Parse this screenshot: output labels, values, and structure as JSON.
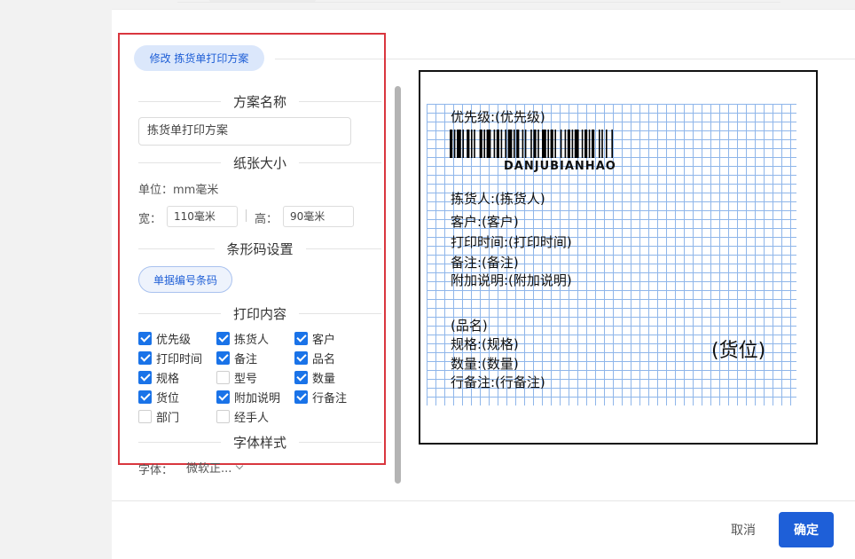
{
  "scheme_tag": "修改 拣货单打印方案",
  "sections": {
    "scheme_name": "方案名称",
    "paper_size": "纸张大小",
    "barcode_settings": "条形码设置",
    "print_content": "打印内容",
    "font_style": "字体样式"
  },
  "scheme_name_value": "拣货单打印方案",
  "unit_text": "单位：mm毫米",
  "width_label": "宽：",
  "width_value": "110毫米",
  "height_label": "高：",
  "height_value": "90毫米",
  "barcode_button": "单据编号条码",
  "print_items": [
    {
      "label": "优先级",
      "checked": true
    },
    {
      "label": "拣货人",
      "checked": true
    },
    {
      "label": "客户",
      "checked": true
    },
    {
      "label": "打印时间",
      "checked": true
    },
    {
      "label": "备注",
      "checked": true
    },
    {
      "label": "品名",
      "checked": true
    },
    {
      "label": "规格",
      "checked": true
    },
    {
      "label": "型号",
      "checked": false
    },
    {
      "label": "数量",
      "checked": true
    },
    {
      "label": "货位",
      "checked": true
    },
    {
      "label": "附加说明",
      "checked": true
    },
    {
      "label": "行备注",
      "checked": true
    },
    {
      "label": "部门",
      "checked": false
    },
    {
      "label": "经手人",
      "checked": false
    }
  ],
  "font_label": "字体：",
  "font_value": "微软正...",
  "preview": {
    "priority": "优先级:(优先级)",
    "barcode_text": "DANJUBIANHAO",
    "picker": "拣货人:(拣货人)",
    "customer": "客户:(客户)",
    "print_time": "打印时间:(打印时间)",
    "remark": "备注:(备注)",
    "extra": "附加说明:(附加说明)",
    "product": "(品名)",
    "spec": "规格:(规格)",
    "qty": "数量:(数量)",
    "line_remark": "行备注:(行备注)",
    "location": "(货位)"
  },
  "footer": {
    "cancel": "取消",
    "confirm": "确定"
  }
}
